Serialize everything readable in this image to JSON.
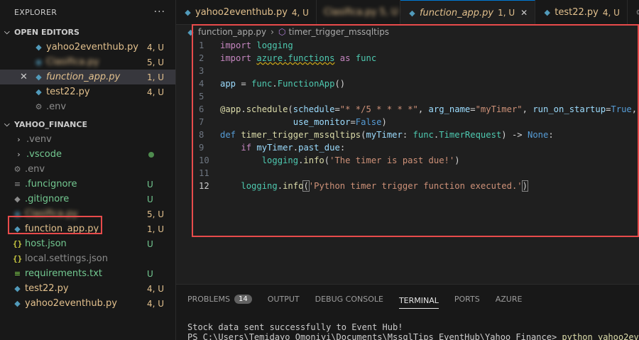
{
  "explorer": {
    "title": "EXPLORER",
    "more": "···",
    "open_editors": {
      "label": "OPEN EDITORS",
      "items": [
        {
          "name": "yahoo2eventhub.py",
          "badge": "4, U"
        },
        {
          "name": "Clasifica.py",
          "badge": "5, U"
        },
        {
          "name": "function_app.py",
          "badge": "1, U"
        },
        {
          "name": "test22.py",
          "badge": "4, U"
        },
        {
          "name": ".env",
          "badge": ""
        }
      ]
    },
    "project": {
      "label": "YAHOO_FINANCE",
      "items": [
        {
          "name": ".venv",
          "badge": ""
        },
        {
          "name": ".vscode",
          "badge": ""
        },
        {
          "name": ".env",
          "badge": ""
        },
        {
          "name": ".funcignore",
          "badge": "U"
        },
        {
          "name": ".gitignore",
          "badge": "U"
        },
        {
          "name": "Clasifica.py",
          "badge": "5, U"
        },
        {
          "name": "function_app.py",
          "badge": "1, U"
        },
        {
          "name": "host.json",
          "badge": "U"
        },
        {
          "name": "local.settings.json",
          "badge": ""
        },
        {
          "name": "requirements.txt",
          "badge": "U"
        },
        {
          "name": "test22.py",
          "badge": "4, U"
        },
        {
          "name": "yahoo2eventhub.py",
          "badge": "4, U"
        }
      ]
    }
  },
  "tabs": [
    {
      "name": "yahoo2eventhub.py",
      "badge": "4, U"
    },
    {
      "name": "Clasifica.py 5, U",
      "badge": ""
    },
    {
      "name": "function_app.py",
      "badge": "1, U"
    },
    {
      "name": "test22.py",
      "badge": "4, U"
    }
  ],
  "breadcrumb": {
    "file": "function_app.py",
    "symbol": "timer_trigger_mssqltips"
  },
  "editor": {
    "line_numbers": [
      "1",
      "2",
      "3",
      "4",
      "5",
      "6",
      "7",
      "8",
      "9",
      "10",
      "11",
      "12"
    ]
  },
  "panel": {
    "tabs": [
      "PROBLEMS",
      "OUTPUT",
      "DEBUG CONSOLE",
      "TERMINAL",
      "PORTS",
      "AZURE"
    ],
    "problems_count": "14",
    "terminal_lines": [
      "Stock data sent successfully to Event Hub!",
      "PS C:\\Users\\Temidayo Omoniyi\\Documents\\MssqlTips EventHub\\Yahoo Finance> "
    ],
    "terminal_command": "python yahoo2event"
  },
  "colors": {
    "accent": "#0078d4",
    "highlight_box": "#e84b4b",
    "modified": "#e2c08d",
    "untracked": "#73c991"
  }
}
